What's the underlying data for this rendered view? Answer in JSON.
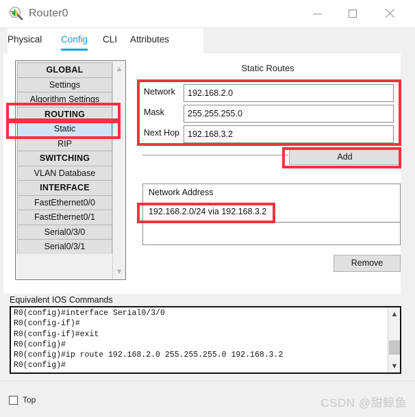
{
  "window": {
    "title": "Router0",
    "icon": "router-icon",
    "controls": {
      "minimize": "minimize-icon",
      "maximize": "maximize-icon",
      "close": "close-icon"
    }
  },
  "tabs": [
    {
      "label": "Physical",
      "active": false
    },
    {
      "label": "Config",
      "active": true
    },
    {
      "label": "CLI",
      "active": false
    },
    {
      "label": "Attributes",
      "active": false
    }
  ],
  "sidebar": {
    "items": [
      {
        "label": "GLOBAL",
        "type": "header",
        "selected": false
      },
      {
        "label": "Settings",
        "type": "item",
        "selected": false
      },
      {
        "label": "Algorithm Settings",
        "type": "item",
        "selected": false
      },
      {
        "label": "ROUTING",
        "type": "header",
        "selected": false
      },
      {
        "label": "Static",
        "type": "item",
        "selected": true
      },
      {
        "label": "RIP",
        "type": "item",
        "selected": false
      },
      {
        "label": "SWITCHING",
        "type": "header",
        "selected": false
      },
      {
        "label": "VLAN Database",
        "type": "item",
        "selected": false
      },
      {
        "label": "INTERFACE",
        "type": "header",
        "selected": false
      },
      {
        "label": "FastEthernet0/0",
        "type": "item",
        "selected": false
      },
      {
        "label": "FastEthernet0/1",
        "type": "item",
        "selected": false
      },
      {
        "label": "Serial0/3/0",
        "type": "item",
        "selected": false
      },
      {
        "label": "Serial0/3/1",
        "type": "item",
        "selected": false
      }
    ],
    "scroll_up": "chevron-up-icon",
    "scroll_down": "chevron-down-icon"
  },
  "static_routes": {
    "title": "Static Routes",
    "fields": [
      {
        "label": "Network",
        "value": "192.168.2.0"
      },
      {
        "label": "Mask",
        "value": "255.255.255.0"
      },
      {
        "label": "Next Hop",
        "value": "192.168.3.2"
      }
    ],
    "add_label": "Add",
    "remove_label": "Remove",
    "list_header": "Network Address",
    "routes": [
      "192.168.2.0/24 via 192.168.3.2"
    ]
  },
  "ios": {
    "label": "Equivalent IOS Commands",
    "lines": "R0(config)#interface Serial0/3/0\nR0(config-if)#\nR0(config-if)#exit\nR0(config)#\nR0(config)#ip route 192.168.2.0 255.255.255.0 192.168.3.2\nR0(config)#",
    "scroll_up": "chevron-up-icon",
    "scroll_down": "chevron-down-icon"
  },
  "bottom": {
    "top_checkbox_label": "Top",
    "top_checked": false,
    "watermark": "CSDN @甜鲸鱼"
  },
  "colors": {
    "accent": "#17a2dd",
    "annotation": "#f5333f",
    "selection": "#cfe4f7",
    "button_face": "#e0e0e0"
  }
}
